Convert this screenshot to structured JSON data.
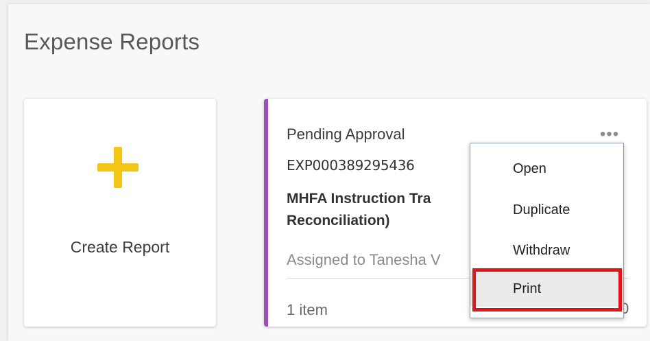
{
  "page": {
    "title": "Expense Reports"
  },
  "create_card": {
    "label": "Create Report",
    "icon": "plus-icon",
    "icon_color": "#f3c515"
  },
  "report_card": {
    "accent_color": "#9b4fb8",
    "status": "Pending Approval",
    "id": "EXP000389295436",
    "title": "MHFA Instruction Tra\nReconciliation)",
    "assigned": "Assigned to Tanesha V",
    "item_count": "1 item",
    "more_icon": "more-horizontal-icon",
    "more_glyph": "•••",
    "trailing_glyph": "0"
  },
  "menu": {
    "items": [
      {
        "label": "Open"
      },
      {
        "label": "Duplicate"
      },
      {
        "label": "Withdraw"
      },
      {
        "label": "Print"
      }
    ],
    "highlighted_item": "Print",
    "highlight_color": "#e3141a"
  }
}
